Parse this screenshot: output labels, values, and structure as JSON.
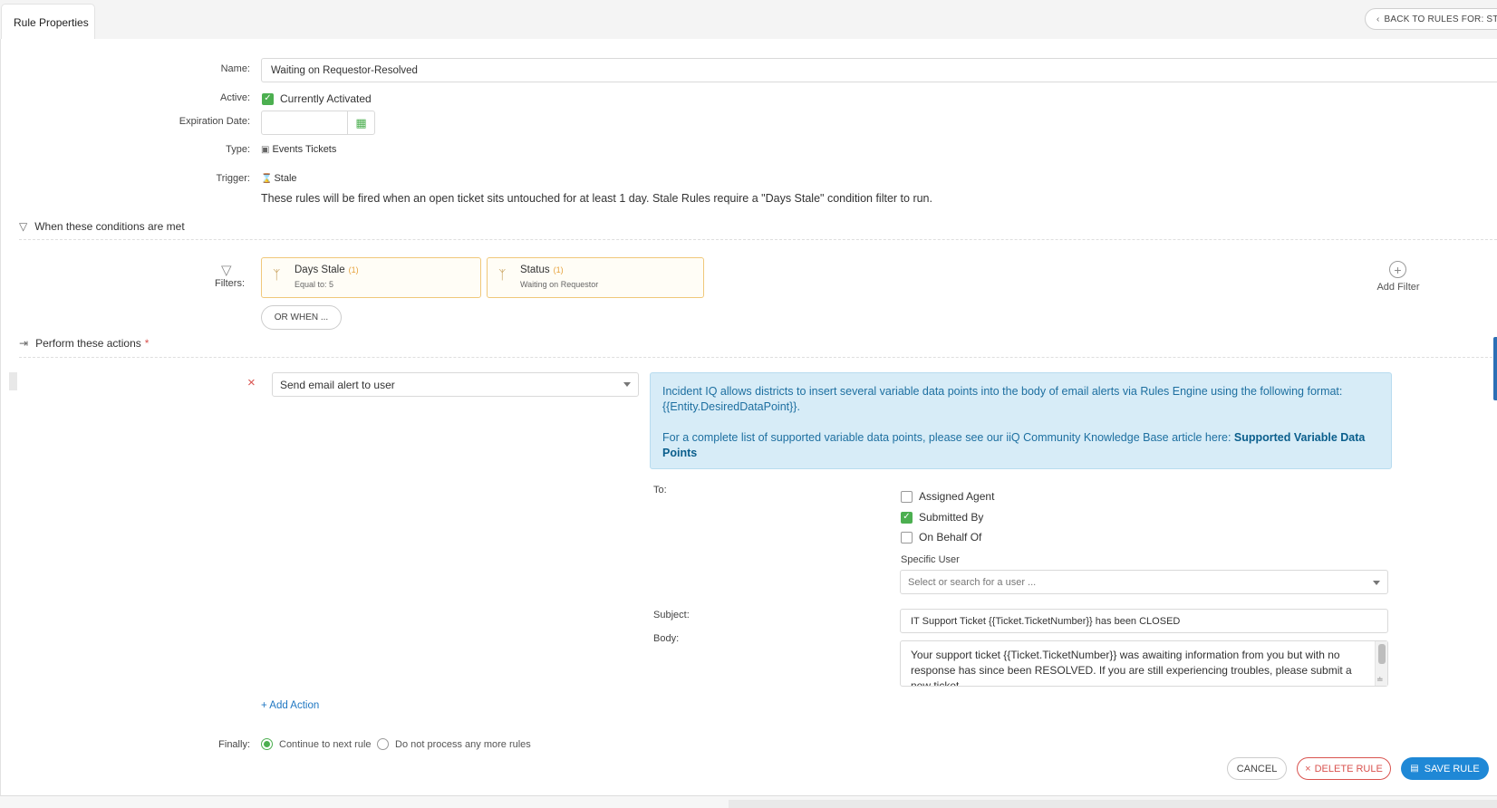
{
  "tab": {
    "label": "Rule Properties"
  },
  "back_button": {
    "label": "BACK TO RULES FOR: STALE"
  },
  "form": {
    "name_label": "Name:",
    "name_value": "Waiting on Requestor-Resolved",
    "active_label": "Active:",
    "active_text": "Currently Activated",
    "expiration_label": "Expiration Date:",
    "expiration_value": "",
    "type_label": "Type:",
    "type_value": "Events Tickets",
    "trigger_label": "Trigger:",
    "trigger_value": "Stale",
    "trigger_desc": "These rules will be fired when an open ticket sits untouched for at least 1 day. Stale Rules require a \"Days Stale\" condition filter to run."
  },
  "conditions": {
    "heading": "When these conditions are met",
    "filters_label": "Filters:",
    "filters": [
      {
        "title": "Days Stale",
        "count": "(1)",
        "sub": "Equal to: 5"
      },
      {
        "title": "Status",
        "count": "(1)",
        "sub": "Waiting on Requestor"
      }
    ],
    "or_when": "OR WHEN ...",
    "add_filter": "Add Filter"
  },
  "actions": {
    "heading": "Perform these actions",
    "required_mark": "*",
    "remove_glyph": "×",
    "action_type": "Send email alert to user",
    "info_p1": "Incident IQ allows districts to insert several variable data points into the body of email alerts via Rules Engine using the following format: {{Entity.DesiredDataPoint}}.",
    "info_p2_prefix": "For a complete list of supported variable data points, please see our iiQ Community Knowledge Base article here: ",
    "info_link": "Supported Variable Data Points",
    "to_label": "To:",
    "recipients": [
      {
        "label": "Assigned Agent",
        "checked": false
      },
      {
        "label": "Submitted By",
        "checked": true
      },
      {
        "label": "On Behalf Of",
        "checked": false
      }
    ],
    "specific_user_label": "Specific User",
    "specific_user_placeholder": "Select or search for a user ...",
    "subject_label": "Subject:",
    "subject_value": "IT Support Ticket {{Ticket.TicketNumber}} has been CLOSED",
    "body_label": "Body:",
    "body_value": "Your support ticket {{Ticket.TicketNumber}} was awaiting information from you but with no response has since been RESOLVED.  If you are still experiencing troubles, please submit a new ticket.",
    "add_action": "+ Add Action"
  },
  "finally": {
    "label": "Finally:",
    "options": [
      {
        "label": "Continue to next rule",
        "selected": true
      },
      {
        "label": "Do not process any more rules",
        "selected": false
      }
    ]
  },
  "buttons": {
    "cancel": "CANCEL",
    "delete": "DELETE RULE",
    "delete_glyph": "×",
    "save": "SAVE RULE"
  },
  "colors": {
    "accent_green": "#4caf50",
    "primary_blue": "#1f88d6",
    "danger_red": "#d9534f",
    "info_bg": "#d7ecf7",
    "filter_border": "#f0c87a"
  }
}
